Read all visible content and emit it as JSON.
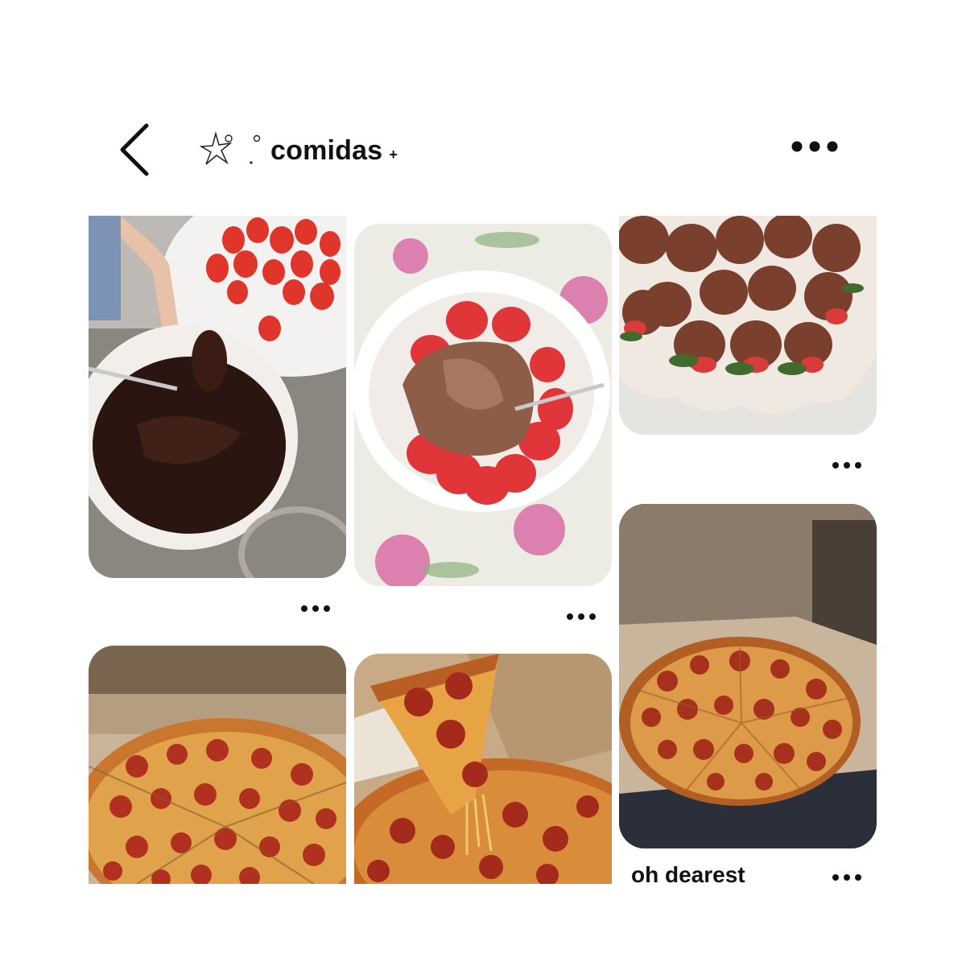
{
  "header": {
    "title": "comidas",
    "plus": "+"
  },
  "icons": {
    "back": "chevron-left-icon",
    "more": "more-horizontal-icon",
    "decoration": "starfish-icon"
  },
  "pins": [
    {
      "subject": "hand dipping strawberry into melted chocolate bowl"
    },
    {
      "subject": "bowl of strawberries with chocolate sauce"
    },
    {
      "subject": "chocolate covered strawberries on scalloped plate"
    },
    {
      "subject": "pepperoni pizza in box"
    },
    {
      "subject": "hand pulling slice of pepperoni pizza"
    },
    {
      "subject": "pepperoni pizza in dominos box",
      "caption": "oh dearest"
    }
  ],
  "colors": {
    "background": "#ffffff",
    "text": "#111111"
  }
}
